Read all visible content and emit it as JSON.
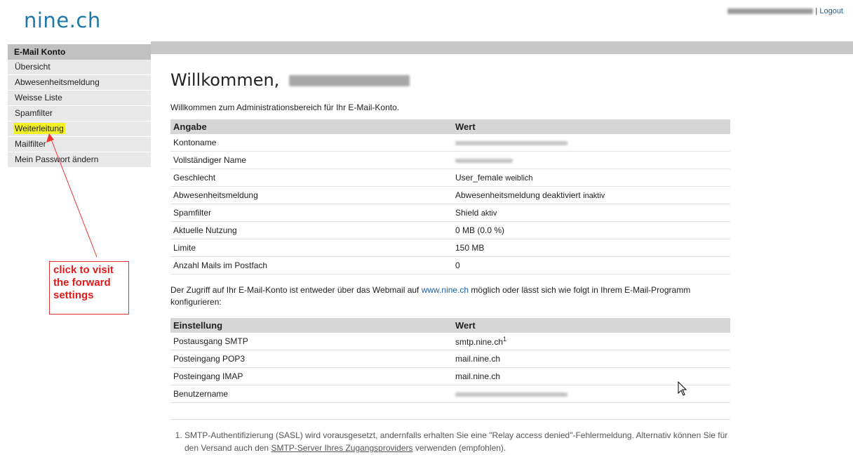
{
  "brand": {
    "logo": "nine.ch"
  },
  "userbar": {
    "separator": "|",
    "logout": "Logout"
  },
  "sidebar": {
    "title": "E-Mail Konto",
    "items": [
      {
        "label": "Übersicht"
      },
      {
        "label": "Abwesenheitsmeldung"
      },
      {
        "label": "Weisse Liste"
      },
      {
        "label": "Spamfilter"
      },
      {
        "label": "Weiterleitung"
      },
      {
        "label": "Mailfilter"
      },
      {
        "label": "Mein Passwort ändern"
      }
    ]
  },
  "main": {
    "title": "Willkommen,",
    "intro": "Willkommen zum Administrationsbereich für Ihr E-Mail-Konto.",
    "account_table": {
      "headers": [
        "Angabe",
        "Wert"
      ],
      "rows": [
        {
          "label": "Kontoname",
          "value": ""
        },
        {
          "label": "Vollständiger Name",
          "value": ""
        },
        {
          "label": "Geschlecht",
          "value": "User_female",
          "sub": "weiblich"
        },
        {
          "label": "Abwesenheitsmeldung",
          "value": "Abwesenheitsmeldung deaktiviert",
          "sub": "inaktiv"
        },
        {
          "label": "Spamfilter",
          "value": "Shield",
          "sub": "aktiv"
        },
        {
          "label": "Aktuelle Nutzung",
          "value": "0 MB (0.0 %)"
        },
        {
          "label": "Limite",
          "value": "150 MB"
        },
        {
          "label": "Anzahl Mails im Postfach",
          "value": "0"
        }
      ]
    },
    "access_text": {
      "before": "Der Zugriff auf Ihr E-Mail-Konto ist entweder über das Webmail auf ",
      "link": "www.nine.ch",
      "after": " möglich oder lässt sich wie folgt in Ihrem E-Mail-Programm konfigurieren:"
    },
    "settings_table": {
      "headers": [
        "Einstellung",
        "Wert"
      ],
      "rows": [
        {
          "label": "Postausgang SMTP",
          "value": "smtp.nine.ch",
          "sup": "1"
        },
        {
          "label": "Posteingang POP3",
          "value": "mail.nine.ch"
        },
        {
          "label": "Posteingang IMAP",
          "value": "mail.nine.ch"
        },
        {
          "label": "Benutzername",
          "value": ""
        }
      ]
    },
    "footnote": {
      "before": "SMTP-Authentifizierung (SASL) wird vorausgesetzt, andernfalls erhalten Sie eine \"Relay access denied\"-Fehlermeldung. Alternativ können Sie für den Versand auch den ",
      "link": "SMTP-Server Ihres Zugangsproviders",
      "after": " verwenden (empfohlen)."
    }
  },
  "annotation": {
    "line1": "click to visit",
    "line2": "the forward",
    "line3": "settings",
    "color": "#e01a1a"
  }
}
